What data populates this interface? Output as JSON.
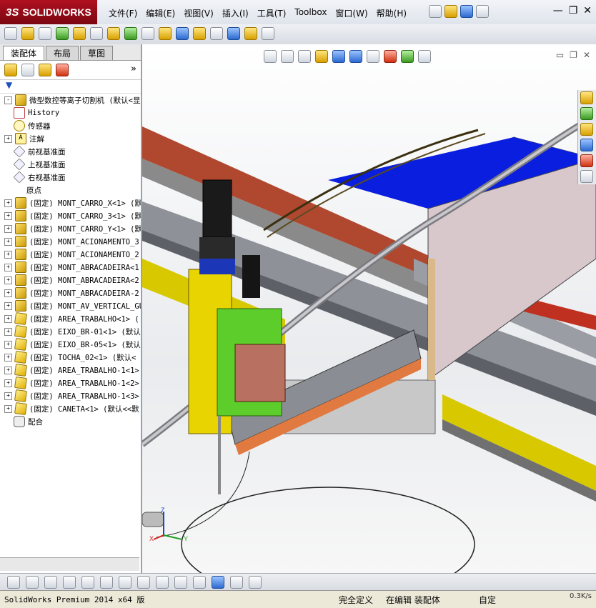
{
  "app": {
    "logo_prefix": "3S",
    "logo_text": "SOLIDWORKS",
    "menu": [
      "文件(F)",
      "编辑(E)",
      "视图(V)",
      "插入(I)",
      "工具(T)",
      "Toolbox",
      "窗口(W)",
      "帮助(H)"
    ]
  },
  "panel": {
    "tabs": [
      "装配体",
      "布局",
      "草图"
    ],
    "filter_icon": "filter-icon",
    "tree": [
      {
        "label": "微型数控等离子切割机  (默认<显",
        "icon": "assembly",
        "expand": "-",
        "indent": 0
      },
      {
        "label": "History",
        "icon": "history",
        "expand": "",
        "indent": 1
      },
      {
        "label": "传感器",
        "icon": "sensor",
        "expand": "",
        "indent": 1
      },
      {
        "label": "注解",
        "icon": "annotation",
        "expand": "+",
        "indent": 1
      },
      {
        "label": "前视基准面",
        "icon": "plane",
        "expand": "",
        "indent": 1
      },
      {
        "label": "上视基准面",
        "icon": "plane",
        "expand": "",
        "indent": 1
      },
      {
        "label": "右视基准面",
        "icon": "plane",
        "expand": "",
        "indent": 1
      },
      {
        "label": "原点",
        "icon": "origin",
        "expand": "",
        "indent": 1
      },
      {
        "label": "(固定) MONT_CARRO_X<1> (默",
        "icon": "assembly",
        "expand": "+",
        "indent": 1
      },
      {
        "label": "(固定) MONT_CARRO_3<1> (默",
        "icon": "assembly",
        "expand": "+",
        "indent": 1
      },
      {
        "label": "(固定) MONT_CARRO_Y<1> (默",
        "icon": "assembly",
        "expand": "+",
        "indent": 1
      },
      {
        "label": "(固定) MONT_ACIONAMENTO_3",
        "icon": "assembly",
        "expand": "+",
        "indent": 1
      },
      {
        "label": "(固定) MONT_ACIONAMENTO_2",
        "icon": "assembly",
        "expand": "+",
        "indent": 1
      },
      {
        "label": "(固定) MONT_ABRACADEIRA<1",
        "icon": "assembly",
        "expand": "+",
        "indent": 1
      },
      {
        "label": "(固定) MONT_ABRACADEIRA<2",
        "icon": "assembly",
        "expand": "+",
        "indent": 1
      },
      {
        "label": "(固定) MONT_ABRACADEIRA-2",
        "icon": "assembly",
        "expand": "+",
        "indent": 1
      },
      {
        "label": "(固定) MONT_AV_VERTICAL_GU",
        "icon": "assembly",
        "expand": "+",
        "indent": 1
      },
      {
        "label": "(固定) AREA_TRABALHO<1> (",
        "icon": "part",
        "expand": "+",
        "indent": 1
      },
      {
        "label": "(固定) EIXO_BR-01<1> (默认",
        "icon": "part",
        "expand": "+",
        "indent": 1
      },
      {
        "label": "(固定) EIXO_BR-05<1> (默认",
        "icon": "part",
        "expand": "+",
        "indent": 1
      },
      {
        "label": "(固定) TOCHA_02<1> (默认<",
        "icon": "part",
        "expand": "+",
        "indent": 1
      },
      {
        "label": "(固定) AREA_TRABALHO-1<1>",
        "icon": "part",
        "expand": "+",
        "indent": 1
      },
      {
        "label": "(固定) AREA_TRABALHO-1<2>",
        "icon": "part",
        "expand": "+",
        "indent": 1
      },
      {
        "label": "(固定) AREA_TRABALHO-1<3>",
        "icon": "part",
        "expand": "+",
        "indent": 1
      },
      {
        "label": "(固定) CANETA<1> (默认<<默",
        "icon": "part",
        "expand": "+",
        "indent": 1
      },
      {
        "label": "配合",
        "icon": "mate",
        "expand": "",
        "indent": 1
      }
    ]
  },
  "triad": {
    "x": "X",
    "y": "Y",
    "z": "Z"
  },
  "status": {
    "left": "SolidWorks Premium 2014 x64 版",
    "fully_defined": "完全定义",
    "editing": "在编辑 装配体",
    "custom": "自定",
    "speed": "0.3K/s"
  },
  "colors": {
    "accent": "#b01020",
    "viewport_top": "#ffffff",
    "blue_cover": "#0a1ee0"
  }
}
